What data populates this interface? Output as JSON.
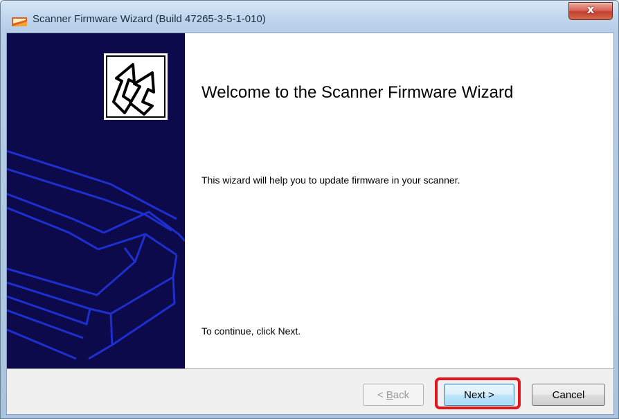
{
  "window": {
    "title": "Scanner Firmware Wizard (Build 47265-3-5-1-010)",
    "close_label": "x"
  },
  "icons": {
    "app": "scanner-app-icon",
    "banner": "arrow-update-icon",
    "close": "close-icon"
  },
  "content": {
    "heading": "Welcome to the Scanner Firmware Wizard",
    "description": "This wizard will help you to update firmware in your scanner.",
    "instruction": "To continue, click Next."
  },
  "buttons": {
    "back": {
      "prefix": "< ",
      "accel": "B",
      "rest": "ack",
      "enabled": false
    },
    "next": {
      "label": "Next >",
      "enabled": true,
      "default": true
    },
    "cancel": {
      "label": "Cancel",
      "enabled": true
    }
  },
  "colors": {
    "banner_bg": "#0c0a4a",
    "banner_lines": "#1e2fd0",
    "highlight": "#e0161c"
  }
}
